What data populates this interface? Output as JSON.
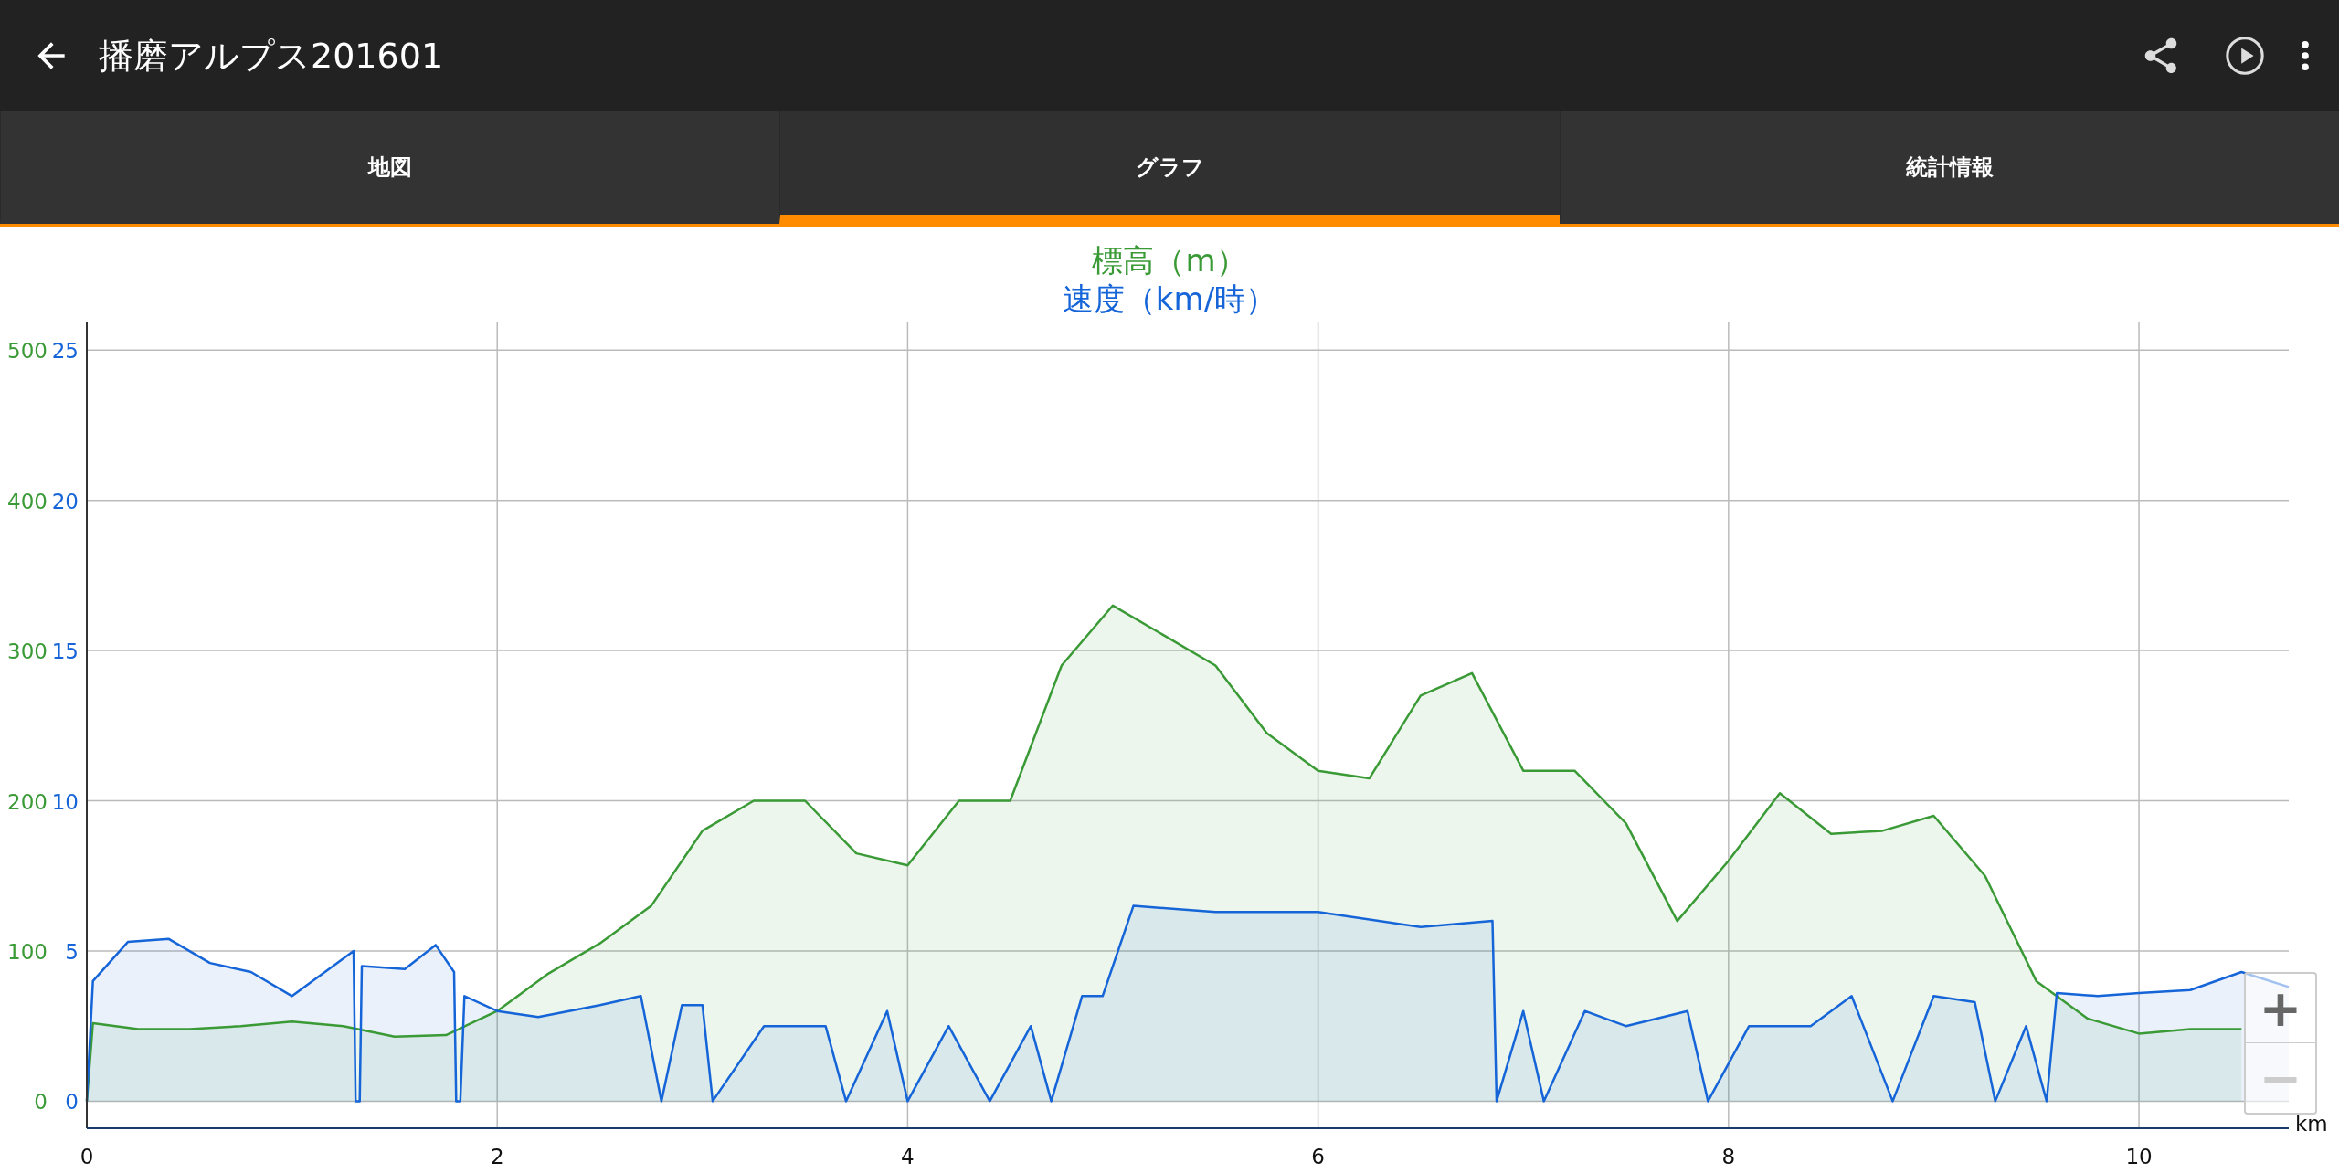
{
  "app_bar": {
    "title": "播磨アルプス201601"
  },
  "tabs": [
    {
      "label": "地図",
      "selected": false
    },
    {
      "label": "グラフ",
      "selected": true
    },
    {
      "label": "統計情報",
      "selected": false
    }
  ],
  "chart": {
    "chart_data": {
      "type": "area",
      "grid": true,
      "xlabel": "km",
      "xlim": [
        0,
        10.73
      ],
      "ylim": [
        -18,
        519
      ],
      "xticks": [
        0,
        2,
        4,
        6,
        8,
        10
      ],
      "yticks": [
        0,
        100,
        200,
        300,
        400,
        500
      ],
      "y2lim": [
        -0.9,
        25.95
      ],
      "y2ticks": [
        0,
        5,
        10,
        15,
        20,
        25
      ],
      "series": [
        {
          "name": "標高（m）",
          "color": "#3a9a36",
          "x": [
            0,
            0.03,
            0.25,
            0.5,
            0.75,
            1,
            1.25,
            1.5,
            1.75,
            2,
            2.25,
            2.5,
            2.75,
            3,
            3.25,
            3.5,
            3.75,
            4,
            4.25,
            4.5,
            4.75,
            5,
            5.25,
            5.5,
            5.75,
            6,
            6.25,
            6.5,
            6.75,
            7,
            7.25,
            7.5,
            7.75,
            8,
            8.25,
            8.5,
            8.75,
            9,
            9.25,
            9.5,
            9.75,
            10,
            10.25,
            10.5
          ],
          "values": [
            0,
            52,
            48,
            48,
            50,
            53,
            50,
            43,
            44,
            60,
            85,
            105,
            130,
            180,
            200,
            200,
            165,
            157,
            200,
            200,
            290,
            330,
            310,
            290,
            245,
            220,
            215,
            270,
            285,
            220,
            220,
            185,
            120,
            160,
            205,
            178,
            180,
            190,
            150,
            80,
            55,
            45,
            48,
            48
          ]
        },
        {
          "name": "速度（km/時）",
          "color": "#1565d8",
          "axis": "y2",
          "x": [
            0,
            0.03,
            0.2,
            0.4,
            0.6,
            0.8,
            1,
            1.2,
            1.3,
            1.31,
            1.33,
            1.34,
            1.55,
            1.7,
            1.79,
            1.8,
            1.82,
            1.84,
            2,
            2.2,
            2.5,
            2.7,
            2.8,
            2.9,
            3,
            3.05,
            3.3,
            3.6,
            3.7,
            3.9,
            4,
            4.2,
            4.4,
            4.6,
            4.7,
            4.85,
            4.95,
            5.1,
            5.5,
            6,
            6.5,
            6.85,
            6.87,
            7,
            7.1,
            7.3,
            7.5,
            7.8,
            7.9,
            8.1,
            8.4,
            8.6,
            8.8,
            9,
            9.2,
            9.3,
            9.45,
            9.55,
            9.6,
            9.8,
            10,
            10.25,
            10.5,
            10.73
          ],
          "values": [
            0,
            4,
            5.3,
            5.4,
            4.6,
            4.3,
            3.5,
            4.5,
            5,
            0,
            0,
            4.5,
            4.4,
            5.2,
            4.3,
            0,
            0,
            3.5,
            3,
            2.8,
            3.2,
            3.5,
            0,
            3.2,
            3.2,
            0,
            2.5,
            2.5,
            0,
            3,
            0,
            2.5,
            0,
            2.5,
            0,
            3.5,
            3.5,
            6.5,
            6.3,
            6.3,
            5.8,
            6,
            0,
            3,
            0,
            3,
            2.5,
            3,
            0,
            2.5,
            2.5,
            3.5,
            0,
            3.5,
            3.3,
            0,
            2.5,
            0,
            3.6,
            3.5,
            3.6,
            3.7,
            4.3,
            3.8
          ]
        }
      ]
    }
  },
  "zoom_controls": [
    {
      "symbol": "+",
      "disabled": false
    },
    {
      "symbol": "−",
      "disabled": true
    }
  ]
}
